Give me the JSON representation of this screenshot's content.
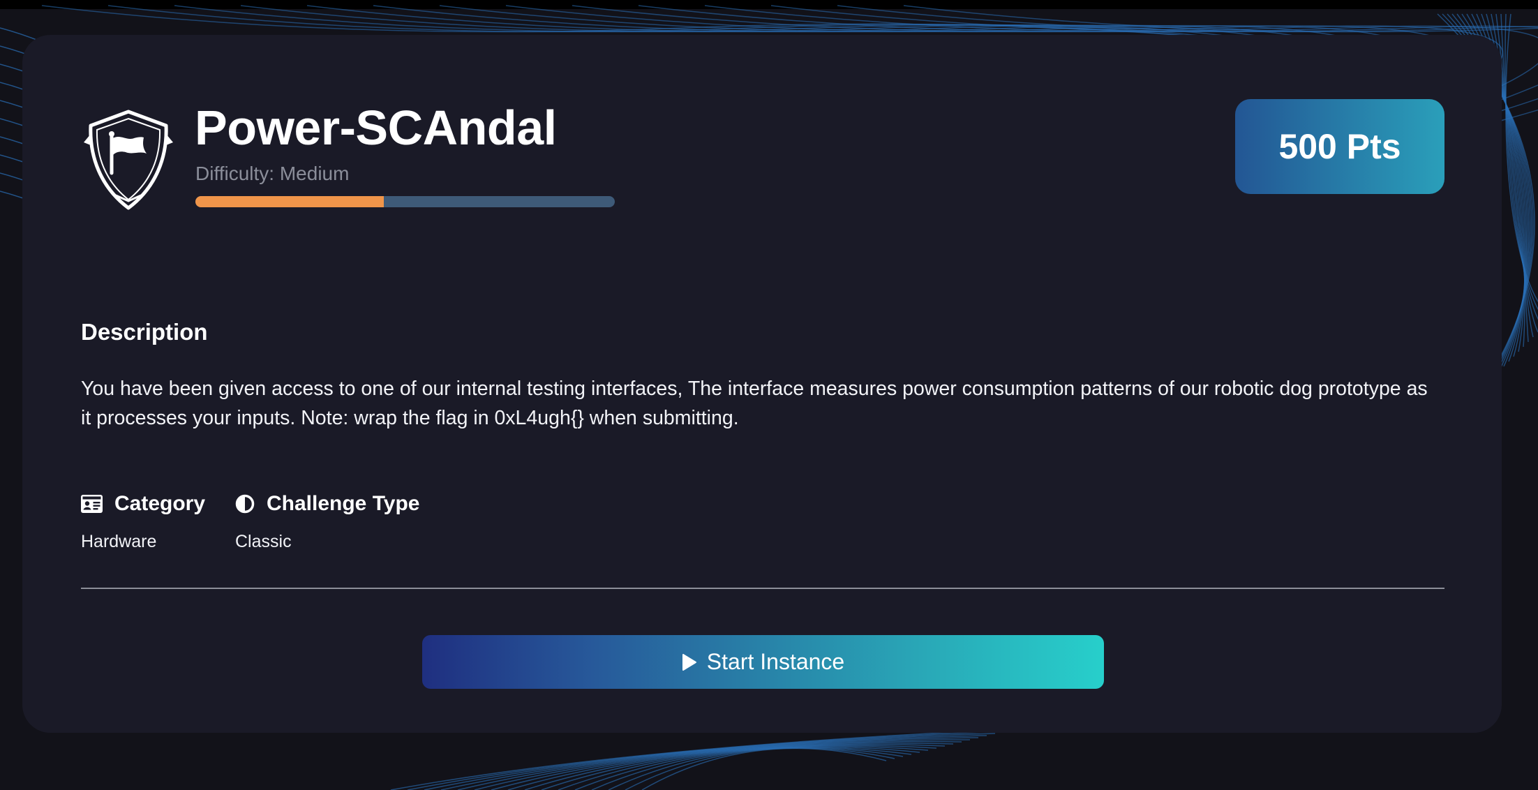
{
  "challenge": {
    "title": "Power-SCAndal",
    "icon": "shield-flag-icon",
    "difficulty_text": "Difficulty: Medium",
    "difficulty_progress": 0.45,
    "points": "500 Pts"
  },
  "description": {
    "heading": "Description",
    "text": "You have been given access to one of our internal testing interfaces, The interface measures power consumption patterns of our robotic dog prototype as it processes your inputs. Note: wrap the flag in 0xL4ugh{} when submitting."
  },
  "meta": {
    "category": {
      "label": "Category",
      "value": "Hardware",
      "icon": "id-card-icon"
    },
    "challenge_type": {
      "label": "Challenge Type",
      "value": "Classic",
      "icon": "half-circle-icon"
    }
  },
  "actions": {
    "start_label": "Start Instance",
    "start_icon": "play-icon"
  },
  "colors": {
    "page_background": "#121219",
    "card_background": "#1a1a27",
    "difficulty_fill": "#f0954a",
    "difficulty_track": "#3e5a78",
    "points_gradient": [
      "#235694",
      "#2a9fba"
    ],
    "button_gradient": [
      "#1f2f80",
      "#27cfcb"
    ],
    "background_lines": "#2a6fb8"
  }
}
